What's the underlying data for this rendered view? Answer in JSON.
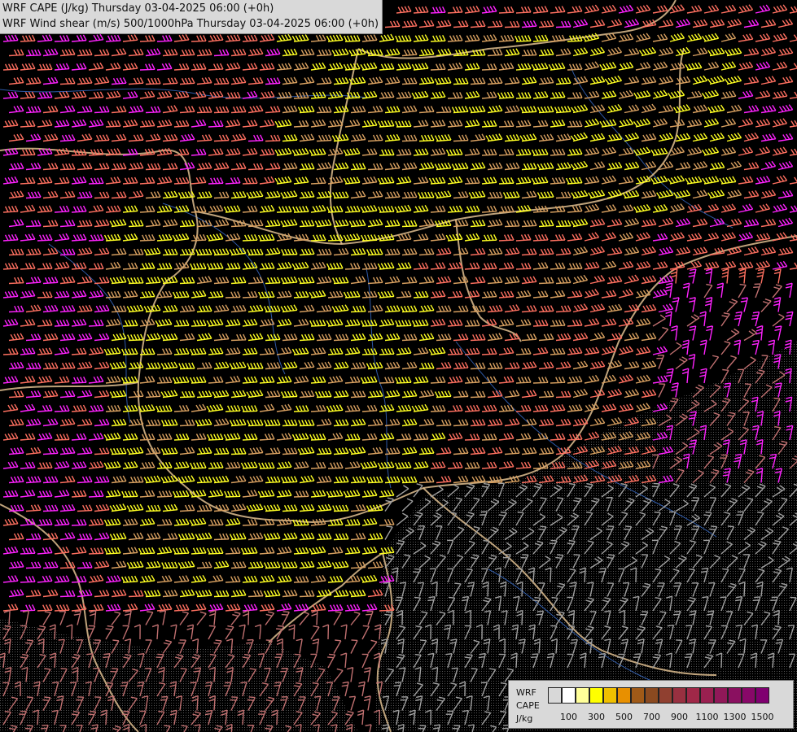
{
  "title": {
    "line1": "WRF CAPE (J/kg) Thursday 03-04-2025 06:00 (+0h)",
    "line2": "WRF Wind shear (m/s) 500/1000hPa Thursday 03-04-2025 06:00 (+0h)"
  },
  "legend": {
    "model": "WRF",
    "variable": "CAPE",
    "unit": "J/kg",
    "bins": [
      {
        "value": 0,
        "color": "#d8d8d8"
      },
      {
        "value": 100,
        "color": "#ffffff"
      },
      {
        "value": 200,
        "color": "#ffff99"
      },
      {
        "value": 300,
        "color": "#ffff00"
      },
      {
        "value": 400,
        "color": "#f0c000"
      },
      {
        "value": 500,
        "color": "#e89000"
      },
      {
        "value": 600,
        "color": "#a05a18"
      },
      {
        "value": 700,
        "color": "#8b4a20"
      },
      {
        "value": 800,
        "color": "#904030"
      },
      {
        "value": 900,
        "color": "#983040"
      },
      {
        "value": 1000,
        "color": "#a02848"
      },
      {
        "value": 1100,
        "color": "#9a2050"
      },
      {
        "value": 1200,
        "color": "#901858"
      },
      {
        "value": 1300,
        "color": "#8a1060"
      },
      {
        "value": 1400,
        "color": "#880868"
      },
      {
        "value": 1500,
        "color": "#800070"
      }
    ],
    "tick_labels": [
      "100",
      "300",
      "500",
      "700",
      "900",
      "1100",
      "1300",
      "1500"
    ]
  },
  "barb_colors": {
    "strong": "#ff22ff",
    "salmon": "#ff7060",
    "tan": "#d8a060",
    "yellow": "#ffff22",
    "pink_muted": "#c07070",
    "grey": "#a0a0a0"
  }
}
